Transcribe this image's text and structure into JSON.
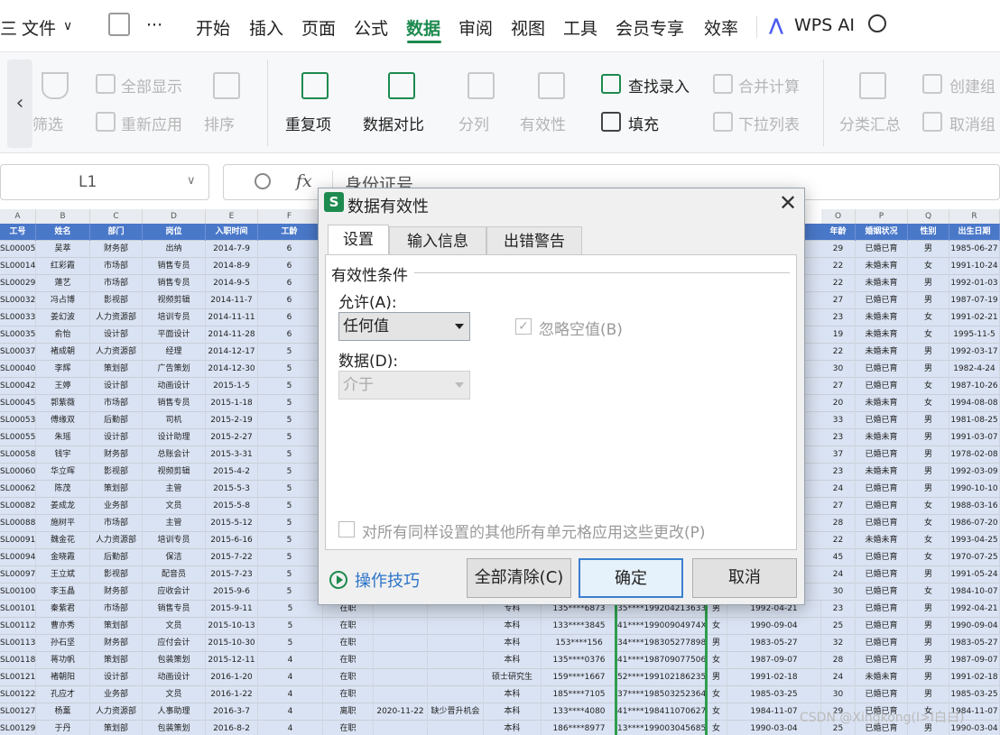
{
  "menubar": {
    "hamburger": "三",
    "file_label": "文件",
    "more": "···",
    "items": [
      "开始",
      "插入",
      "页面",
      "公式",
      "数据",
      "审阅",
      "视图",
      "工具",
      "会员专享",
      "效率"
    ],
    "wps_ai": "WPS AI"
  },
  "ribbon": {
    "filter": "筛选",
    "show_all": "全部显示",
    "reapply": "重新应用",
    "sort": "排序",
    "duplicates": "重复项",
    "compare": "数据对比",
    "split": "分列",
    "validity": "有效性",
    "find_entry": "查找录入",
    "fill": "填充",
    "merge_calc": "合并计算",
    "dropdown_list": "下拉列表",
    "subtotal": "分类汇总",
    "create_group": "创建组",
    "ungroup": "取消组"
  },
  "formula_bar": {
    "cell_ref": "L1",
    "fx": "fx",
    "content": "身份证号"
  },
  "sheet": {
    "col_letters": [
      "A",
      "B",
      "C",
      "D",
      "E",
      "F",
      "O",
      "P",
      "Q",
      "R"
    ],
    "headers_left": [
      "工号",
      "姓名",
      "部门",
      "岗位",
      "入职时间",
      "工龄"
    ],
    "headers_right": [
      "年龄",
      "婚姻状况",
      "性别",
      "出生日期"
    ],
    "rows_top": [
      [
        "SL00005",
        "吴萃",
        "财务部",
        "出纳",
        "2014-7-9",
        "6",
        "29",
        "已婚已育",
        "男",
        "1985-06-27"
      ],
      [
        "SL00014",
        "红彩霞",
        "市场部",
        "销售专员",
        "2014-8-9",
        "6",
        "22",
        "未婚未育",
        "女",
        "1991-10-24"
      ],
      [
        "SL00029",
        "蓮艺",
        "市场部",
        "销售专员",
        "2014-9-5",
        "6",
        "22",
        "未婚未育",
        "男",
        "1992-01-03"
      ],
      [
        "SL00032",
        "冯占博",
        "影视部",
        "视频剪辑",
        "2014-11-7",
        "6",
        "27",
        "已婚已育",
        "男",
        "1987-07-19"
      ],
      [
        "SL00033",
        "姜幻波",
        "人力资源部",
        "培训专员",
        "2014-11-11",
        "6",
        "23",
        "未婚未育",
        "女",
        "1991-02-21"
      ],
      [
        "SL00035",
        "俞怡",
        "设计部",
        "平面设计",
        "2014-11-28",
        "6",
        "19",
        "未婚未育",
        "女",
        "1995-11-5"
      ],
      [
        "SL00037",
        "褚成朝",
        "人力资源部",
        "经理",
        "2014-12-17",
        "5",
        "22",
        "未婚未育",
        "男",
        "1992-03-17"
      ],
      [
        "SL00040",
        "李辉",
        "策划部",
        "广告策划",
        "2014-12-30",
        "5",
        "30",
        "已婚已育",
        "男",
        "1982-4-24"
      ],
      [
        "SL00042",
        "王婷",
        "设计部",
        "动画设计",
        "2015-1-5",
        "5",
        "27",
        "已婚已育",
        "女",
        "1987-10-26"
      ],
      [
        "SL00045",
        "郭紫薇",
        "市场部",
        "销售专员",
        "2015-1-18",
        "5",
        "20",
        "未婚未育",
        "女",
        "1994-08-08"
      ],
      [
        "SL00053",
        "傅缘双",
        "后勤部",
        "司机",
        "2015-2-19",
        "5",
        "33",
        "已婚已育",
        "男",
        "1981-08-25"
      ],
      [
        "SL00055",
        "朱瑶",
        "设计部",
        "设计助理",
        "2015-2-27",
        "5",
        "23",
        "未婚未育",
        "男",
        "1991-03-07"
      ],
      [
        "SL00058",
        "钱宇",
        "财务部",
        "总账会计",
        "2015-3-31",
        "5",
        "37",
        "已婚已育",
        "男",
        "1978-02-08"
      ],
      [
        "SL00060",
        "华立晖",
        "影视部",
        "视频剪辑",
        "2015-4-2",
        "5",
        "23",
        "未婚未育",
        "男",
        "1992-03-09"
      ],
      [
        "SL00062",
        "陈茂",
        "策划部",
        "主管",
        "2015-5-3",
        "5",
        "24",
        "已婚已育",
        "男",
        "1990-10-10"
      ],
      [
        "SL00082",
        "姜成龙",
        "业务部",
        "文员",
        "2015-5-8",
        "5",
        "27",
        "已婚已育",
        "女",
        "1988-03-16"
      ],
      [
        "SL00088",
        "施树平",
        "市场部",
        "主管",
        "2015-5-12",
        "5",
        "28",
        "已婚已育",
        "女",
        "1986-07-20"
      ],
      [
        "SL00091",
        "魏金花",
        "人力资源部",
        "培训专员",
        "2015-6-16",
        "5",
        "22",
        "未婚未育",
        "女",
        "1993-04-25"
      ],
      [
        "SL00094",
        "金晓霞",
        "后勤部",
        "保洁",
        "2015-7-22",
        "5",
        "45",
        "已婚已育",
        "女",
        "1970-07-25"
      ],
      [
        "SL00097",
        "王立斌",
        "影视部",
        "配音员",
        "2015-7-23",
        "5",
        "24",
        "已婚已育",
        "男",
        "1991-05-24"
      ],
      [
        "SL00100",
        "李玉晶",
        "财务部",
        "应收会计",
        "2015-9-6",
        "5",
        "30",
        "已婚已育",
        "女",
        "1984-10-07"
      ]
    ],
    "rows_bottom": [
      [
        "SL00101",
        "秦紫君",
        "市场部",
        "销售专员",
        "2015-9-11",
        "5",
        "在职",
        "",
        "",
        "专科",
        "135****6873",
        "35****19920421363​3",
        "男",
        "1992-04-21",
        "23",
        "已婚已育",
        "男",
        "1992-04-21"
      ],
      [
        "SL00112",
        "曹亦秀",
        "策划部",
        "文员",
        "2015-10-13",
        "5",
        "在职",
        "",
        "",
        "本科",
        "133****3845",
        "41****19900904974X",
        "女",
        "1990-09-04",
        "25",
        "已婚已育",
        "男",
        "1990-09-04"
      ],
      [
        "SL00113",
        "孙石坚",
        "财务部",
        "应付会计",
        "2015-10-30",
        "5",
        "在职",
        "",
        "",
        "本科",
        "153****156",
        "34****198305277898",
        "男",
        "1983-05-27",
        "32",
        "已婚已育",
        "男",
        "1983-05-27"
      ],
      [
        "SL00118",
        "蒋功帆",
        "策划部",
        "包装策划",
        "2015-12-11",
        "4",
        "在职",
        "",
        "",
        "本科",
        "135****0376",
        "41****198709077506",
        "女",
        "1987-09-07",
        "28",
        "已婚已育",
        "男",
        "1987-09-07"
      ],
      [
        "SL00121",
        "褚朝阳",
        "设计部",
        "动画设计",
        "2016-1-20",
        "4",
        "在职",
        "",
        "",
        "硕士研究生",
        "159****1667",
        "52****199102186235",
        "男",
        "1991-02-18",
        "24",
        "未婚未育",
        "男",
        "1991-02-18"
      ],
      [
        "SL00122",
        "孔应才",
        "业务部",
        "文员",
        "2016-1-22",
        "4",
        "在职",
        "",
        "",
        "本科",
        "185****7105",
        "37****198503252364",
        "女",
        "1985-03-25",
        "30",
        "已婚已育",
        "男",
        "1985-03-25"
      ],
      [
        "SL00127",
        "杨薰",
        "人力资源部",
        "人事助理",
        "2016-3-7",
        "4",
        "离职",
        "2020-11-22",
        "缺少晋升机会",
        "本科",
        "133****4080",
        "41****198411070627",
        "女",
        "1984-11-07",
        "29",
        "已婚已育",
        "女",
        "1984-11-07"
      ],
      [
        "SL00129",
        "于丹",
        "策划部",
        "包装策划",
        "2016-8-2",
        "4",
        "在职",
        "",
        "",
        "本科",
        "186****8977",
        "13****199003045685",
        "女",
        "1990-03-04",
        "25",
        "已婚已育",
        "男",
        "1990-03-04"
      ]
    ]
  },
  "dialog": {
    "title": "数据有效性",
    "tabs": [
      "设置",
      "输入信息",
      "出错警告"
    ],
    "section": "有效性条件",
    "allow_label": "允许(A):",
    "allow_value": "任何值",
    "ignore_blank": "忽略空值(B)",
    "data_label": "数据(D):",
    "data_value": "介于",
    "apply_all": "对所有同样设置的其他所有单元格应用这些更改(P)",
    "tips": "操作技巧",
    "clear_all": "全部清除(C)",
    "ok": "确定",
    "cancel": "取消",
    "close": "✕"
  },
  "watermark": "CSDN @Xingkong(I>I白白)"
}
